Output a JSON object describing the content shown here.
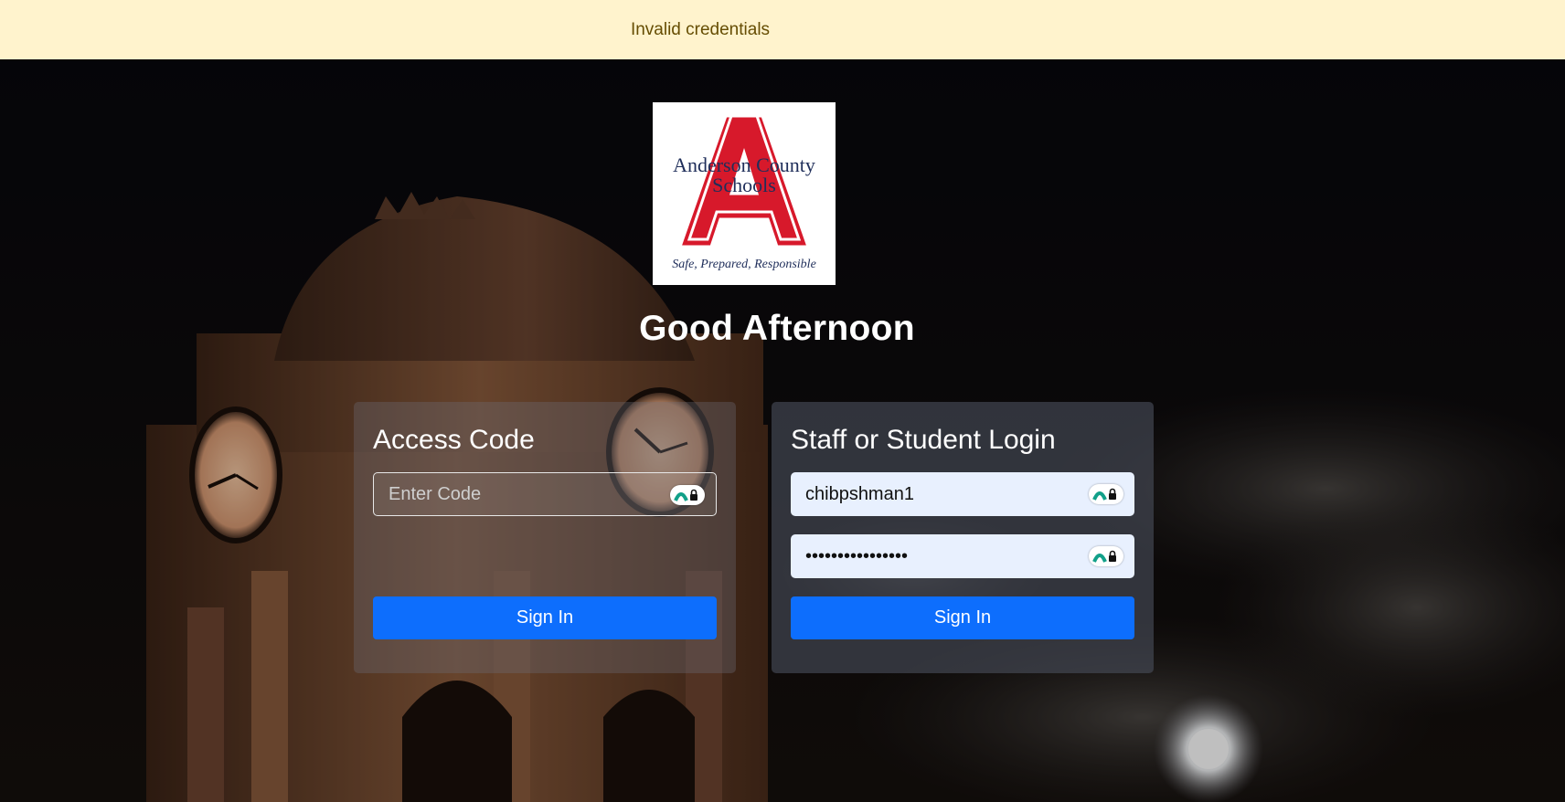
{
  "alert": {
    "message": "Invalid credentials",
    "background": "#fff3cd"
  },
  "logo": {
    "name_line1": "Anderson County",
    "name_line2": "Schools",
    "motto": "Safe, Prepared, Responsible",
    "letter": "A",
    "letter_color": "#d7192b",
    "text_color": "#1f2e5a"
  },
  "greeting": "Good Afternoon",
  "access_code_card": {
    "title": "Access Code",
    "code_placeholder": "Enter Code",
    "code_value": "",
    "password_manager_icon": "password-manager-icon",
    "sign_in_label": "Sign In"
  },
  "login_card": {
    "title": "Staff or Student Login",
    "username_value": "chibpshman1",
    "password_value": "passwordpassword",
    "password_manager_icon": "password-manager-icon",
    "sign_in_label": "Sign In"
  },
  "colors": {
    "primary_button": "#0d6efd",
    "autofill_bg": "#e8f0fe"
  }
}
